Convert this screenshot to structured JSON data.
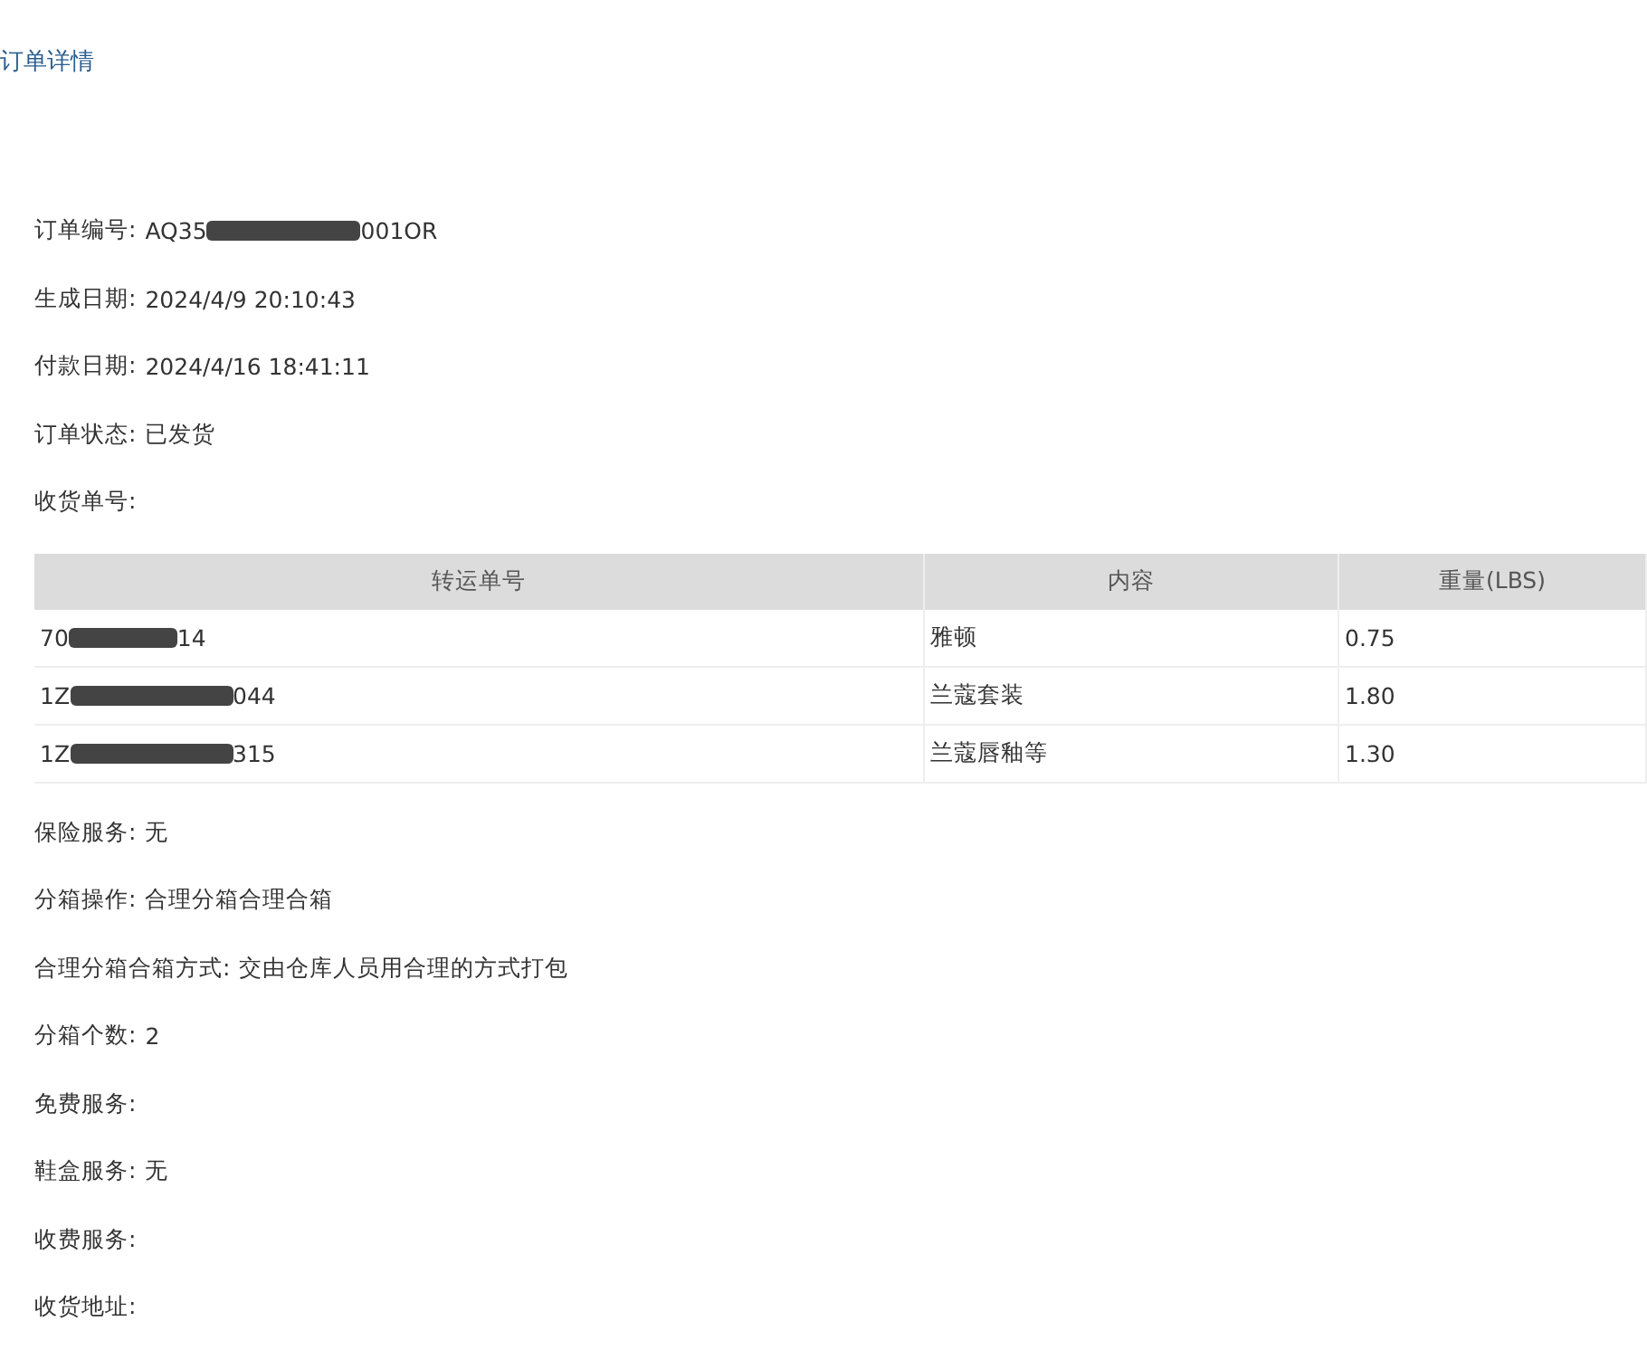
{
  "header_link": "订单详情",
  "fields_top": [
    {
      "kind": "redacted",
      "label": "订单编号:",
      "prefix": "AQ35",
      "suffix": "001OR"
    },
    {
      "kind": "plain",
      "label": "生成日期:",
      "value": "2024/4/9 20:10:43"
    },
    {
      "kind": "plain",
      "label": "付款日期:",
      "value": "2024/4/16 18:41:11"
    },
    {
      "kind": "plain",
      "label": "订单状态:",
      "value": "已发货"
    },
    {
      "kind": "plain",
      "label": "收货单号:"
    }
  ],
  "table": {
    "columns": [
      "转运单号",
      "内容",
      "重量(LBS)"
    ],
    "rows": [
      {
        "tracking_prefix": "70",
        "tracking_suffix": "14",
        "content": "雅顿",
        "weight": "0.75"
      },
      {
        "tracking_prefix": "1Z",
        "tracking_suffix": "044",
        "content": "兰蔻套装",
        "weight": "1.80"
      },
      {
        "tracking_prefix": "1Z",
        "tracking_suffix": "315",
        "content": "兰蔻唇釉等",
        "weight": "1.30"
      }
    ]
  },
  "fields_bottom": [
    {
      "kind": "plain",
      "label": "保险服务:",
      "value": "无"
    },
    {
      "kind": "plain",
      "label": "分箱操作:",
      "value": "合理分箱合理合箱"
    },
    {
      "kind": "plain",
      "label": "合理分箱合箱方式:",
      "value": "交由仓库人员用合理的方式打包"
    },
    {
      "kind": "plain",
      "label": "分箱个数:",
      "value": "2"
    },
    {
      "kind": "plain",
      "label": "免费服务:"
    },
    {
      "kind": "plain",
      "label": "鞋盒服务:",
      "value": "无"
    },
    {
      "kind": "plain",
      "label": "收费服务:"
    },
    {
      "kind": "plain",
      "label": "收货地址:"
    }
  ]
}
